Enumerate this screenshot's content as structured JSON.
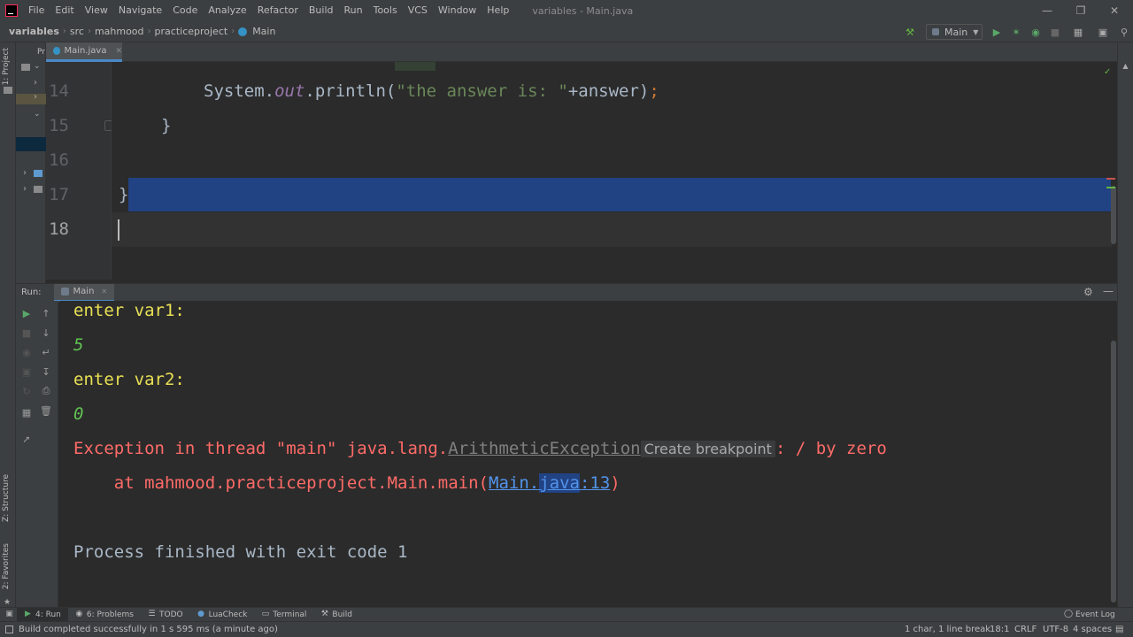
{
  "menubar": {
    "items": [
      "File",
      "Edit",
      "View",
      "Navigate",
      "Code",
      "Analyze",
      "Refactor",
      "Build",
      "Run",
      "Tools",
      "VCS",
      "Window",
      "Help"
    ],
    "window_title": "variables - Main.java"
  },
  "navbar": {
    "crumbs": [
      "variables",
      "src",
      "mahmood",
      "practiceproject",
      "Main"
    ],
    "run_config": "Main"
  },
  "left_strip": {
    "project_tab": "1: Project",
    "structure_tab": "Z: Structure",
    "favorites_tab": "2: Favorites"
  },
  "project_panel": {
    "label": "Pr"
  },
  "editor": {
    "tab_label": "Main.java",
    "lines": [
      {
        "num": "14",
        "code_prefix": "System.",
        "code_field": "out",
        "code_call": ".println(",
        "code_string": "\"the answer is: \"",
        "code_rest": "+answer)",
        "code_semi": ";"
      },
      {
        "num": "15",
        "code": "}"
      },
      {
        "num": "16",
        "code": ""
      },
      {
        "num": "17",
        "code": "}"
      },
      {
        "num": "18",
        "code": ""
      }
    ]
  },
  "run_panel": {
    "label": "Run:",
    "tab_label": "Main",
    "console": {
      "line1": "enter var1:",
      "line2": "5",
      "line3": "enter var2:",
      "line4": "0",
      "exception_prefix": "Exception in thread \"main\" java.lang.",
      "exception_class": "ArithmeticException",
      "breakpoint_hint": "Create breakpoint",
      "exception_suffix": ": / by zero",
      "at_prefix": "    at mahmood.practiceproject.Main.main(",
      "link_main": "Main.",
      "link_java": "java",
      "link_line": ":13",
      "at_suffix": ")",
      "process_finished": "Process finished with exit code 1"
    }
  },
  "bottom_bar": {
    "run": "4: Run",
    "problems": "6: Problems",
    "todo": "TODO",
    "luacheck": "LuaCheck",
    "terminal": "Terminal",
    "build": "Build",
    "event_log": "Event Log"
  },
  "status_bar": {
    "message": "Build completed successfully in 1 s 595 ms (a minute ago)",
    "selection": "1 char, 1 line break",
    "position": "18:1",
    "line_sep": "CRLF",
    "encoding": "UTF-8",
    "indent": "4 spaces"
  },
  "colors": {
    "accent": "#4a88c7",
    "selection": "#214283",
    "error": "#ff6b68",
    "output": "#e8e055",
    "input": "#62c354",
    "link": "#5394ec"
  }
}
